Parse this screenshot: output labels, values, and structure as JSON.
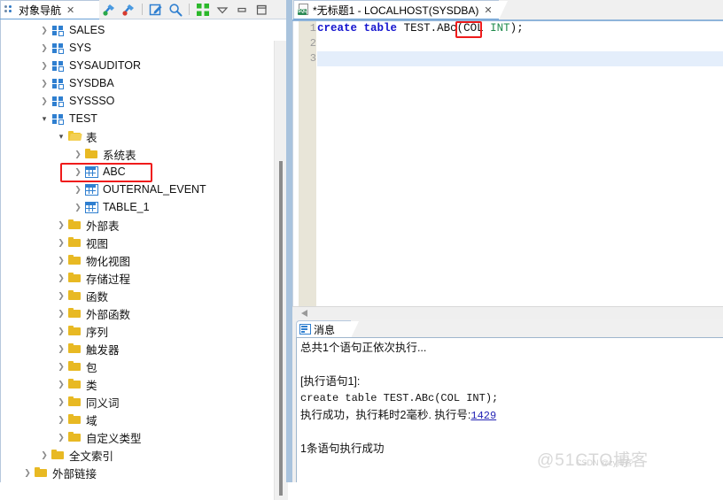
{
  "left_panel": {
    "tab": {
      "label": "对象导航",
      "icon": "object-navigator-icon",
      "close": "✕"
    },
    "toolbar": [
      {
        "name": "connect-icon",
        "title": "连接"
      },
      {
        "name": "disconnect-icon",
        "title": "断开"
      },
      {
        "name": "edit-icon",
        "title": "编辑"
      },
      {
        "name": "search-icon",
        "title": "查找"
      },
      {
        "name": "collapse-all-icon",
        "title": "全部折叠"
      },
      {
        "name": "view-menu-icon",
        "title": "视图菜单"
      },
      {
        "name": "minimize-icon",
        "title": "最小化"
      },
      {
        "name": "maximize-icon",
        "title": "最大化"
      }
    ],
    "tree": [
      {
        "label": "SALES",
        "icon": "schema",
        "indent": 1,
        "state": "collapsed"
      },
      {
        "label": "SYS",
        "icon": "schema",
        "indent": 1,
        "state": "collapsed"
      },
      {
        "label": "SYSAUDITOR",
        "icon": "schema",
        "indent": 1,
        "state": "collapsed"
      },
      {
        "label": "SYSDBA",
        "icon": "schema",
        "indent": 1,
        "state": "collapsed"
      },
      {
        "label": "SYSSSO",
        "icon": "schema",
        "indent": 1,
        "state": "collapsed"
      },
      {
        "label": "TEST",
        "icon": "schema",
        "indent": 1,
        "state": "expanded"
      },
      {
        "label": "表",
        "icon": "folder-open",
        "indent": 2,
        "state": "expanded"
      },
      {
        "label": "系统表",
        "icon": "folder",
        "indent": 3,
        "state": "collapsed"
      },
      {
        "label": "ABC",
        "icon": "table",
        "indent": 3,
        "state": "collapsed",
        "highlight": true
      },
      {
        "label": "OUTERNAL_EVENT",
        "icon": "table",
        "indent": 3,
        "state": "collapsed"
      },
      {
        "label": "TABLE_1",
        "icon": "table",
        "indent": 3,
        "state": "collapsed"
      },
      {
        "label": "外部表",
        "icon": "folder",
        "indent": 2,
        "state": "collapsed"
      },
      {
        "label": "视图",
        "icon": "folder",
        "indent": 2,
        "state": "collapsed"
      },
      {
        "label": "物化视图",
        "icon": "folder",
        "indent": 2,
        "state": "collapsed"
      },
      {
        "label": "存储过程",
        "icon": "folder",
        "indent": 2,
        "state": "collapsed"
      },
      {
        "label": "函数",
        "icon": "folder",
        "indent": 2,
        "state": "collapsed"
      },
      {
        "label": "外部函数",
        "icon": "folder",
        "indent": 2,
        "state": "collapsed"
      },
      {
        "label": "序列",
        "icon": "folder",
        "indent": 2,
        "state": "collapsed"
      },
      {
        "label": "触发器",
        "icon": "folder",
        "indent": 2,
        "state": "collapsed"
      },
      {
        "label": "包",
        "icon": "folder",
        "indent": 2,
        "state": "collapsed"
      },
      {
        "label": "类",
        "icon": "folder",
        "indent": 2,
        "state": "collapsed"
      },
      {
        "label": "同义词",
        "icon": "folder",
        "indent": 2,
        "state": "collapsed"
      },
      {
        "label": "域",
        "icon": "folder",
        "indent": 2,
        "state": "collapsed"
      },
      {
        "label": "自定义类型",
        "icon": "folder",
        "indent": 2,
        "state": "collapsed"
      },
      {
        "label": "全文索引",
        "icon": "folder",
        "indent": 1,
        "state": "collapsed"
      },
      {
        "label": "外部链接",
        "icon": "folder",
        "indent": 0,
        "state": "collapsed"
      }
    ]
  },
  "editor": {
    "tab": {
      "label": "*无标题1 - LOCALHOST(SYSDBA)",
      "icon": "sql-file-icon",
      "close": "✕"
    },
    "lines": [
      {
        "num": "1",
        "tokens": [
          {
            "t": "create",
            "c": "kw"
          },
          {
            "t": " ",
            "c": "pn"
          },
          {
            "t": "table",
            "c": "kw"
          },
          {
            "t": " ",
            "c": "pn"
          },
          {
            "t": "TEST",
            "c": "id"
          },
          {
            "t": ".",
            "c": "pn"
          },
          {
            "t": "ABc",
            "c": "id"
          },
          {
            "t": "(",
            "c": "pn"
          },
          {
            "t": "COL",
            "c": "id"
          },
          {
            "t": " ",
            "c": "pn"
          },
          {
            "t": "INT",
            "c": "ty"
          },
          {
            "t": ")",
            "c": "pn"
          },
          {
            "t": ";",
            "c": "pn"
          }
        ],
        "current": false
      },
      {
        "num": "2",
        "tokens": [],
        "current": false
      },
      {
        "num": "3",
        "tokens": [],
        "current": true
      }
    ],
    "highlight_token": "ABc"
  },
  "messages": {
    "tab": {
      "label": "消息",
      "icon": "message-icon"
    },
    "lines": [
      {
        "text": "总共1个语句正依次执行...",
        "mono": false
      },
      {
        "text": "",
        "mono": false
      },
      {
        "text": "[执行语句1]:",
        "mono": false
      },
      {
        "text": "create table TEST.ABc(COL INT);",
        "mono": true
      },
      {
        "text": "执行成功，执行耗时2毫秒. 执行号:",
        "mono": false,
        "link": "1429"
      },
      {
        "text": "",
        "mono": false
      },
      {
        "text": "1条语句执行成功",
        "mono": false
      }
    ]
  },
  "watermark": {
    "primary": "@51CTO博客",
    "secondary": "CSDN @zy博客"
  },
  "colors": {
    "tab_underline": "#6aa1d6",
    "highlight_red": "#ef1b1b",
    "keyword_blue": "#1414ce",
    "type_green": "#1f8b4c",
    "folder_yellow": "#e8b923",
    "table_blue": "#2f7fd0",
    "current_line": "#e4eefb",
    "gutter": "#e8e5d8"
  }
}
